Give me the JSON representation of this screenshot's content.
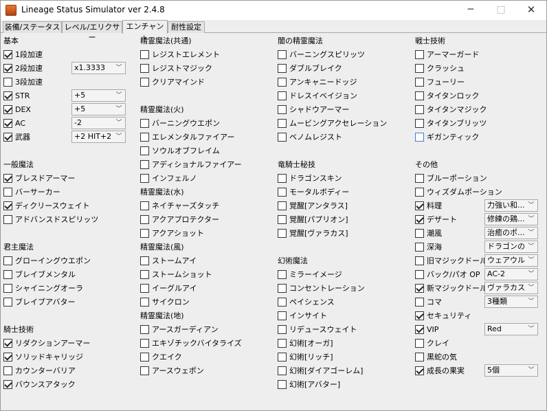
{
  "window": {
    "title": "Lineage Status Simulator ver 2.4.8",
    "icon": "app-icon",
    "minimize": "─",
    "maximize": "□",
    "close": "✕"
  },
  "tabs": [
    "装備/ステータス",
    "レベル/エリクサー",
    "エンチャント",
    "耐性設定"
  ],
  "col1": {
    "kihon": {
      "title": "基本",
      "items": [
        {
          "label": "1段加速",
          "checked": true
        },
        {
          "label": "2段加速",
          "checked": true,
          "select": "x1.3333"
        },
        {
          "label": "3段加速",
          "checked": false
        },
        {
          "label": "STR",
          "checked": true,
          "select": "+5"
        },
        {
          "label": "DEX",
          "checked": true,
          "select": "+5"
        },
        {
          "label": "AC",
          "checked": true,
          "select": "-2"
        },
        {
          "label": "武器",
          "checked": true,
          "select": "+2 HIT+2"
        }
      ]
    },
    "ippan": {
      "title": "一般魔法",
      "items": [
        {
          "label": "ブレスドアーマー",
          "checked": true
        },
        {
          "label": "バーサーカー",
          "checked": false
        },
        {
          "label": "ディクリースウェイト",
          "checked": true
        },
        {
          "label": "アドバンスドスピリッツ",
          "checked": false
        }
      ]
    },
    "kunshu": {
      "title": "君主魔法",
      "items": [
        {
          "label": "グローイングウエポン",
          "checked": false
        },
        {
          "label": "ブレイブメンタル",
          "checked": false
        },
        {
          "label": "シャイニングオーラ",
          "checked": false
        },
        {
          "label": "ブレイブアバター",
          "checked": false
        }
      ]
    },
    "kishi": {
      "title": "騎士技術",
      "items": [
        {
          "label": "リダクションアーマー",
          "checked": true
        },
        {
          "label": "ソリッドキャリッジ",
          "checked": true
        },
        {
          "label": "カウンターバリア",
          "checked": false
        },
        {
          "label": "バウンスアタック",
          "checked": true
        }
      ]
    }
  },
  "col2": {
    "kyotsu": {
      "title": "精霊魔法(共通)",
      "items": [
        {
          "label": "レジストエレメント",
          "checked": false
        },
        {
          "label": "レジストマジック",
          "checked": false
        },
        {
          "label": "クリアマインド",
          "checked": false
        }
      ]
    },
    "hi": {
      "title": "精霊魔法(火)",
      "items": [
        {
          "label": "バーニングウエポン",
          "checked": false
        },
        {
          "label": "エレメンタルファイアー",
          "checked": false
        },
        {
          "label": "ソウルオブフレイム",
          "checked": false
        },
        {
          "label": "アディショナルファイアー",
          "checked": false
        },
        {
          "label": "インフェルノ",
          "checked": false
        }
      ]
    },
    "mizu": {
      "title": "精霊魔法(水)",
      "items": [
        {
          "label": "ネイチャーズタッチ",
          "checked": false
        },
        {
          "label": "アクアプロテクター",
          "checked": false
        },
        {
          "label": "アクアショット",
          "checked": false
        }
      ]
    },
    "kaze": {
      "title": "精霊魔法(風)",
      "items": [
        {
          "label": "ストームアイ",
          "checked": false
        },
        {
          "label": "ストームショット",
          "checked": false
        },
        {
          "label": "イーグルアイ",
          "checked": false
        },
        {
          "label": "サイクロン",
          "checked": false
        }
      ]
    },
    "chi": {
      "title": "精霊魔法(地)",
      "items": [
        {
          "label": "アースガーディアン",
          "checked": false
        },
        {
          "label": "エキゾチックバイタライズ",
          "checked": false
        },
        {
          "label": "クエイク",
          "checked": false
        },
        {
          "label": "アースウェポン",
          "checked": false
        }
      ]
    }
  },
  "col3": {
    "yami": {
      "title": "闇の精霊魔法",
      "items": [
        {
          "label": "バーニングスピリッツ",
          "checked": false
        },
        {
          "label": "ダブルブレイク",
          "checked": false
        },
        {
          "label": "アンキャニードッジ",
          "checked": false
        },
        {
          "label": "ドレスイベイジョン",
          "checked": false
        },
        {
          "label": "シャドウアーマー",
          "checked": false
        },
        {
          "label": "ムービングアクセレーション",
          "checked": false
        },
        {
          "label": "ベノムレジスト",
          "checked": false
        }
      ]
    },
    "ryukishi": {
      "title": "竜騎士秘技",
      "items": [
        {
          "label": "ドラゴンスキン",
          "checked": false
        },
        {
          "label": "モータルボディー",
          "checked": false
        },
        {
          "label": "覚醒[アンタラス]",
          "checked": false
        },
        {
          "label": "覚醒[パプリオン]",
          "checked": false
        },
        {
          "label": "覚醒[ヴァラカス]",
          "checked": false
        }
      ]
    },
    "genjutsu": {
      "title": "幻術魔法",
      "items": [
        {
          "label": "ミラーイメージ",
          "checked": false
        },
        {
          "label": "コンセントレーション",
          "checked": false
        },
        {
          "label": "ペイシェンス",
          "checked": false
        },
        {
          "label": "インサイト",
          "checked": false
        },
        {
          "label": "リデュースウェイト",
          "checked": false
        },
        {
          "label": "幻術[オーガ]",
          "checked": false
        },
        {
          "label": "幻術[リッチ]",
          "checked": false
        },
        {
          "label": "幻術[ダイアゴーレム]",
          "checked": false
        },
        {
          "label": "幻術[アバター]",
          "checked": false
        }
      ]
    }
  },
  "col4": {
    "senshi": {
      "title": "戦士技術",
      "items": [
        {
          "label": "アーマーガード",
          "checked": false
        },
        {
          "label": "クラッシュ",
          "checked": false
        },
        {
          "label": "フューリー",
          "checked": false
        },
        {
          "label": "タイタンロック",
          "checked": false
        },
        {
          "label": "タイタンマジック",
          "checked": false
        },
        {
          "label": "タイタンブリッツ",
          "checked": false
        },
        {
          "label": "ギガンティック",
          "checked": false,
          "focused": true
        }
      ]
    },
    "sonota": {
      "title": "その他",
      "items": [
        {
          "label": "ブルーポーション",
          "checked": false
        },
        {
          "label": "ウィズダムポーション",
          "checked": false
        },
        {
          "label": "料理",
          "checked": true,
          "select": "力強い和..."
        },
        {
          "label": "デザート",
          "checked": true,
          "select": "修練の鶏..."
        },
        {
          "label": "潮風",
          "checked": false,
          "select": "治癒のポ..."
        },
        {
          "label": "深海",
          "checked": false,
          "select": "ドラゴンの..."
        },
        {
          "label": "旧マジックドール",
          "checked": false,
          "select": "ウェアウルフ"
        },
        {
          "label": "バック/パオ OP",
          "checked": false,
          "select": "AC-2"
        },
        {
          "label": "新マジックドール",
          "checked": true,
          "select": "ヴァラカス"
        },
        {
          "label": "コマ",
          "checked": false,
          "select": "3種類"
        },
        {
          "label": "セキュリティ",
          "checked": true
        },
        {
          "label": "VIP",
          "checked": true,
          "select": "Red"
        },
        {
          "label": "クレイ",
          "checked": false
        },
        {
          "label": "黒蛇の気",
          "checked": false
        },
        {
          "label": "成長の果実",
          "checked": true,
          "select": "5個"
        }
      ]
    }
  }
}
